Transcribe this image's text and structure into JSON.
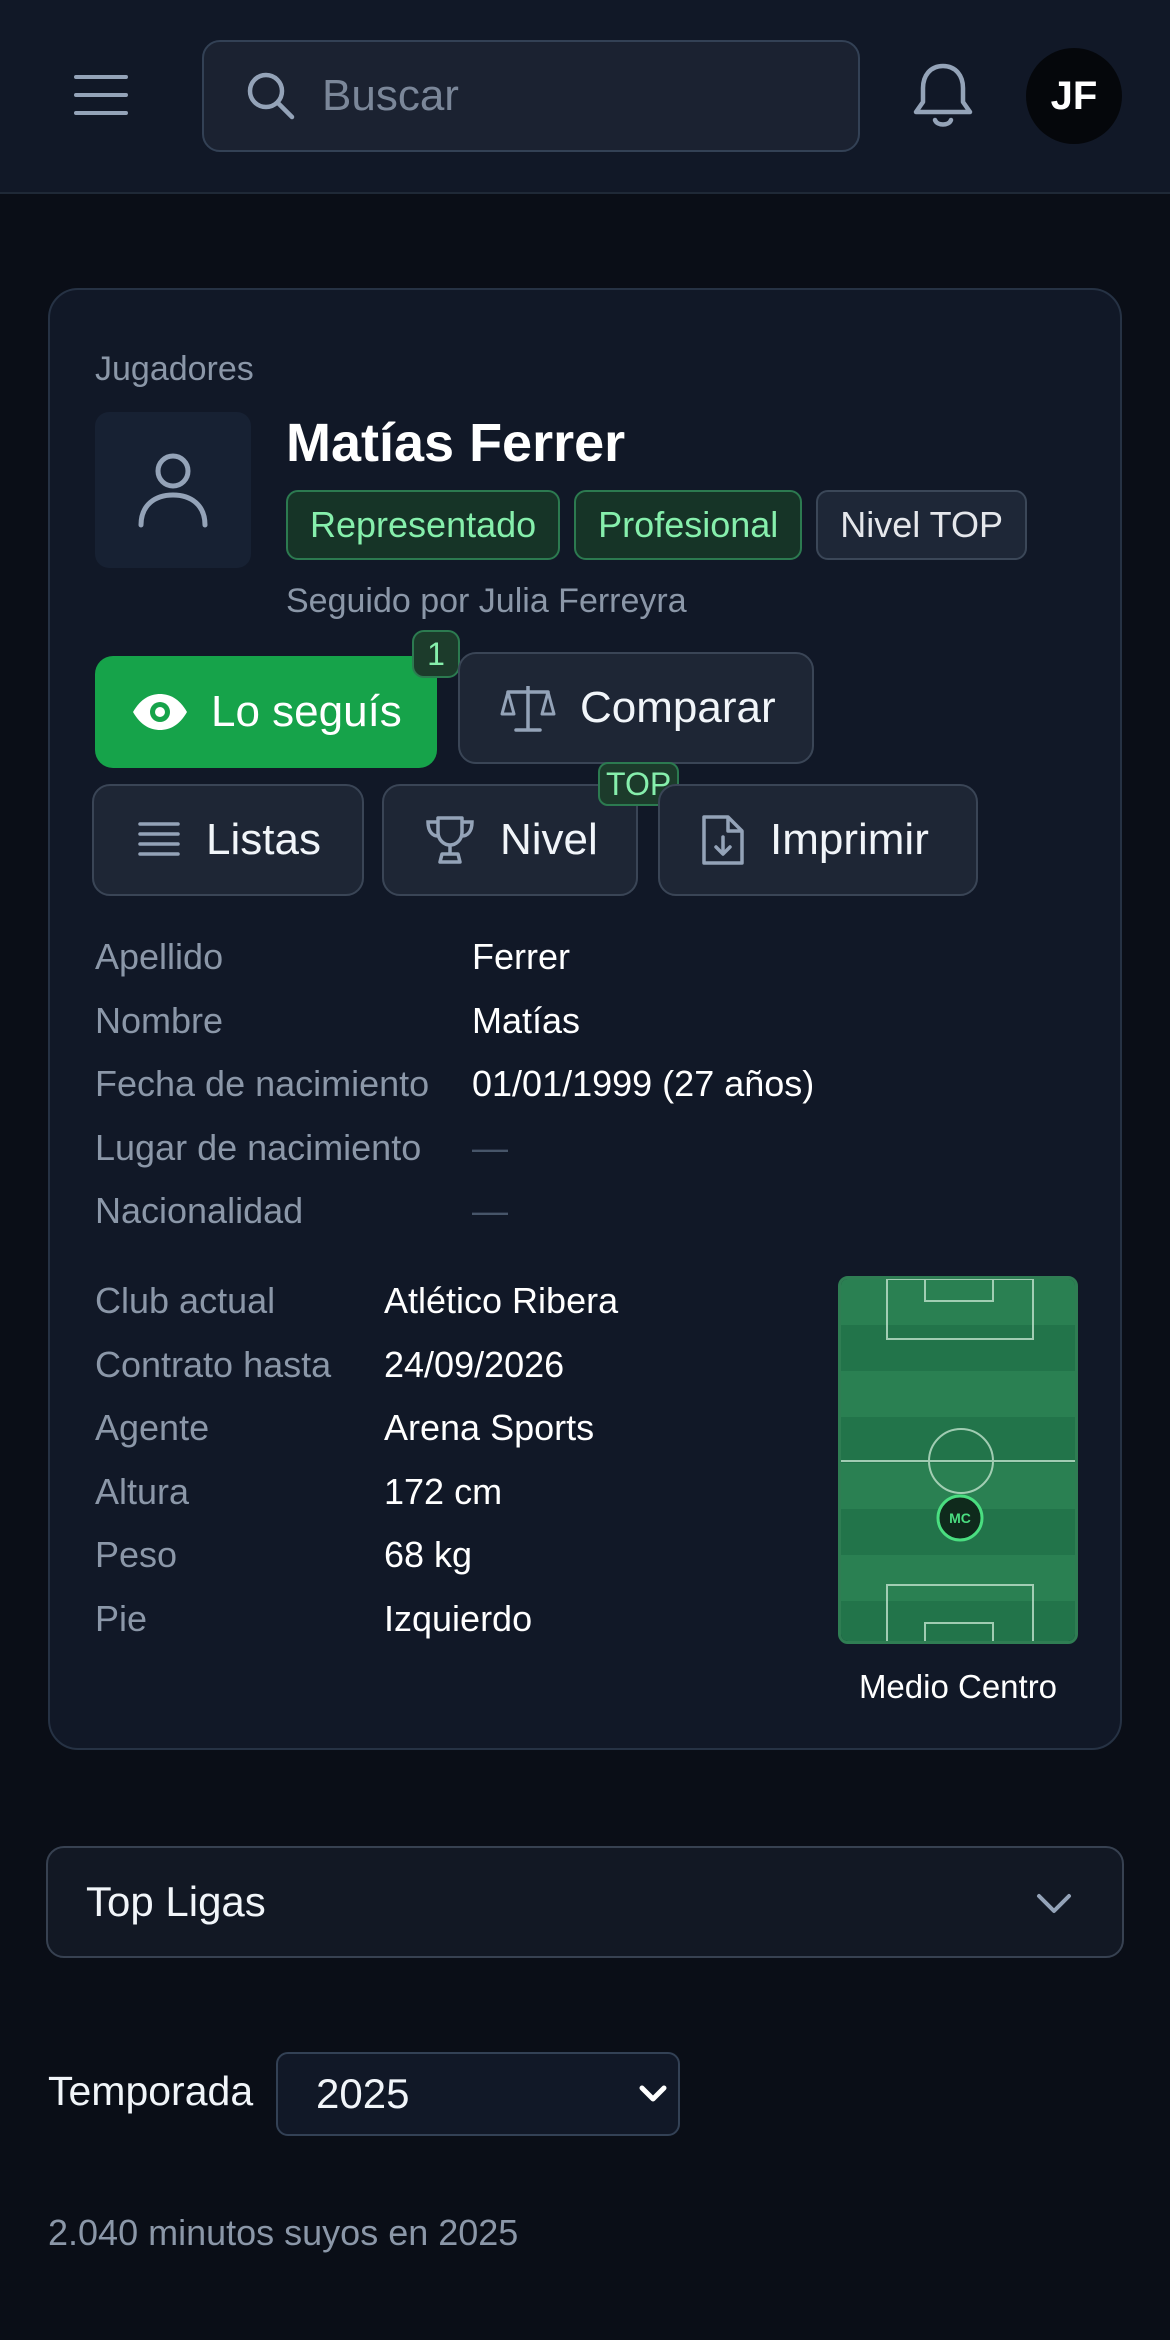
{
  "header": {
    "search_placeholder": "Buscar",
    "avatar_initials": "JF"
  },
  "player": {
    "breadcrumb": "Jugadores",
    "name": "Matías Ferrer",
    "badges": [
      "Representado",
      "Profesional",
      "Nivel TOP"
    ],
    "followed_by": "Seguido por Julia Ferreyra"
  },
  "actions": {
    "follow_label": "Lo seguís",
    "follow_count": "1",
    "compare_label": "Comparar",
    "lists_label": "Listas",
    "level_label": "Nivel",
    "level_badge": "TOP",
    "print_label": "Imprimir"
  },
  "personal": [
    {
      "label": "Apellido",
      "value": "Ferrer"
    },
    {
      "label": "Nombre",
      "value": "Matías"
    },
    {
      "label": "Fecha de nacimiento",
      "value": "01/01/1999 (27 años)"
    },
    {
      "label": "Lugar de nacimiento",
      "value": "—"
    },
    {
      "label": "Nacionalidad",
      "value": "—"
    }
  ],
  "club": [
    {
      "label": "Club actual",
      "value": "Atlético Ribera"
    },
    {
      "label": "Contrato hasta",
      "value": "24/09/2026"
    },
    {
      "label": "Agente",
      "value": "Arena Sports"
    },
    {
      "label": "Altura",
      "value": "172 cm"
    },
    {
      "label": "Peso",
      "value": "68 kg"
    },
    {
      "label": "Pie",
      "value": "Izquierdo"
    }
  ],
  "position": {
    "code": "MC",
    "label": "Medio Centro"
  },
  "leagues": {
    "label": "Top Ligas"
  },
  "season": {
    "label": "Temporada",
    "selected": "2025"
  },
  "minutes_text": "2.040 minutos suyos en 2025",
  "colors": {
    "accent_green": "#16a34a",
    "badge_green_text": "#86efac",
    "background": "#0a0e17",
    "card": "#111827"
  }
}
